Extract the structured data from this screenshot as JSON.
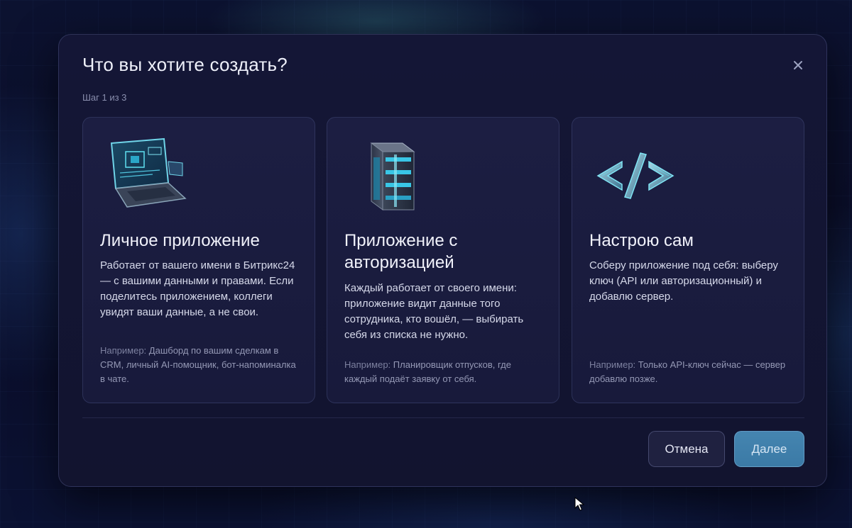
{
  "dialog": {
    "title": "Что вы хотите создать?",
    "step": "Шаг 1 из 3",
    "close_icon": "close-icon"
  },
  "cards": [
    {
      "icon": "laptop-icon",
      "title": "Личное приложение",
      "description": "Работает от вашего имени в Битрикс24 — с вашими данными и правами. Если поделитесь приложением, коллеги увидят ваши данные, а не свои.",
      "example_prefix": "Например:",
      "example": " Дашборд по вашим сделкам в CRM, личный AI-помощник, бот-напоминалка в чате."
    },
    {
      "icon": "server-cube-icon",
      "title": "Приложение с авторизацией",
      "description": "Каждый работает от своего имени: приложение видит данные того сотрудника, кто вошёл, — выбирать себя из списка не нужно.",
      "example_prefix": "Например:",
      "example": " Планировщик отпусков, где каждый подаёт заявку от себя."
    },
    {
      "icon": "code-brackets-icon",
      "title": "Настрою сам",
      "description": "Соберу приложение под себя: выберу ключ (API или авторизационный) и добавлю сервер.",
      "example_prefix": "Например:",
      "example": " Только API-ключ сейчас — сервер добавлю позже."
    }
  ],
  "footer": {
    "cancel_label": "Отмена",
    "next_label": "Далее"
  },
  "colors": {
    "background": "#0b0f2a",
    "modal": "#141636",
    "card": "#1c1e42",
    "accent": "#3f7fab"
  }
}
